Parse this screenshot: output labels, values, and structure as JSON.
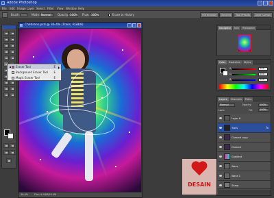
{
  "app": {
    "title": "Adobe Photoshop"
  },
  "menu": [
    "File",
    "Edit",
    "Image",
    "Layer",
    "Select",
    "Filter",
    "View",
    "Window",
    "Help"
  ],
  "options_bar": {
    "brush_label": "Brush:",
    "mode_label": "Mode:",
    "mode_value": "Normal",
    "opacity_label": "Opacity:",
    "opacity_value": "100%",
    "flow_label": "Flow:",
    "flow_value": "100%",
    "history_label": "Erase to History",
    "panel_tabs": [
      "File Browser",
      "Brushes",
      "Tool Presets",
      "Layer Comps"
    ]
  },
  "document": {
    "title": "Childrens.psd @ 36.4% (Trails, RGB/8)",
    "status_zoom": "36.4%",
    "status_doc": "Doc: 6.93M/59.3M"
  },
  "context_menu": {
    "items": [
      {
        "label": "Eraser Tool",
        "shortcut": "E",
        "selected": true
      },
      {
        "label": "Background Eraser Tool",
        "shortcut": "E",
        "selected": false
      },
      {
        "label": "Magic Eraser Tool",
        "shortcut": "E",
        "selected": false
      }
    ]
  },
  "panels": {
    "navigator_tabs": [
      "Navigator",
      "Info",
      "Histogram"
    ],
    "color_tabs": [
      "Color",
      "Swatches",
      "Styles"
    ],
    "color_values": {
      "r": "255",
      "g": "255",
      "b": "255"
    },
    "layers_tabs": [
      "Layers",
      "Channels",
      "Paths"
    ],
    "blend_mode": "Normal",
    "opacity_label": "Opacity:",
    "opacity_value": "100%",
    "lock_label": "Lock:",
    "fill_label": "Fill:",
    "fill_value": "100%",
    "layers": [
      {
        "name": "Layer 6",
        "selected": false,
        "thumb_color": "#555555"
      },
      {
        "name": "Trails",
        "selected": true,
        "thumb_color": "#222222",
        "fx": "fx"
      },
      {
        "name": "Channel copy",
        "selected": false,
        "thumb_color": "#3b2a4a"
      },
      {
        "name": "Channel",
        "selected": false,
        "thumb_color": "#3b2a4a"
      },
      {
        "name": "Gradient",
        "selected": false,
        "thumb_color": "#d23a8a"
      },
      {
        "name": "Wave",
        "selected": false,
        "thumb_color": "#666666"
      },
      {
        "name": "Wave 1",
        "selected": false,
        "thumb_color": "#666666"
      },
      {
        "name": "Sharp",
        "selected": false,
        "thumb_color": "#777777"
      }
    ]
  },
  "watermark": {
    "text": "DESAIN"
  },
  "colors": {
    "titlebar": "#1b3a8a",
    "selection": "#2b4f9c",
    "watermark_red": "#d21818"
  }
}
